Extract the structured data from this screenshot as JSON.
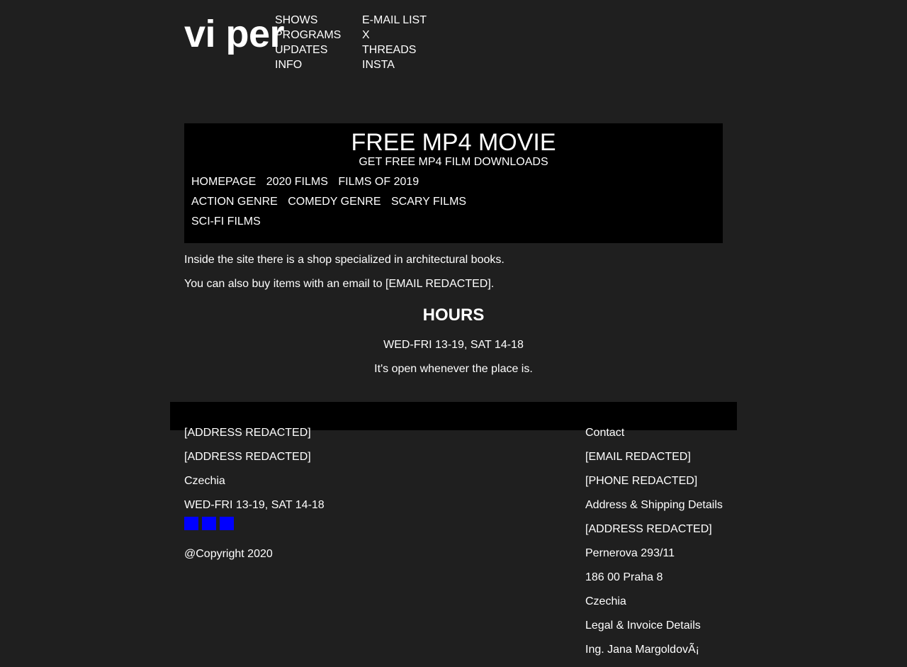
{
  "header": {
    "logo": "vi per",
    "nav_left": [
      "SHOWS",
      "PROGRAMS",
      "UPDATES",
      "INFO"
    ],
    "nav_right": [
      "E-MAIL LIST",
      "X",
      "THREADS",
      "INSTA"
    ]
  },
  "banner": {
    "title": "FREE MP4 MOVIE",
    "subtitle": "GET FREE MP4 FILM DOWNLOADS",
    "links_row1": [
      "HOMEPAGE",
      "2020 FILMS",
      "FILMS OF 2019"
    ],
    "links_row2": [
      "ACTION GENRE",
      "COMEDY GENRE",
      "SCARY FILMS"
    ],
    "links_row3": [
      "SCI-FI FILMS"
    ]
  },
  "content": {
    "para1": "Inside the site there is a shop specialized in architectural books.",
    "para2": "You can also buy items with an email to [EMAIL REDACTED].",
    "hours_title": "HOURS",
    "hours_text": "WED-FRI 13-19, SAT 14-18",
    "hours_note": "It's open whenever the place is."
  },
  "footer": {
    "left_lines": [
      "[ADDRESS REDACTED]",
      "[ADDRESS REDACTED]",
      "Czechia",
      "WED-FRI 13-19, SAT 14-18"
    ],
    "social_icons": [
      "social-icon",
      "social-icon",
      "social-icon"
    ],
    "social_color": "#0000ff",
    "copyright": "@Copyright 2020",
    "right_lines": [
      "Contact",
      "[EMAIL REDACTED]",
      "[PHONE REDACTED]",
      "Address & Shipping Details",
      "[ADDRESS REDACTED]",
      "Pernerova 293/11",
      "186 00 Praha 8",
      "Czechia",
      "Legal & Invoice Details",
      "Ing. Jana MargoldovÃ¡"
    ]
  },
  "colors": {
    "background": "#1f1f1f",
    "banner": "#000000",
    "text": "#ffffff"
  }
}
